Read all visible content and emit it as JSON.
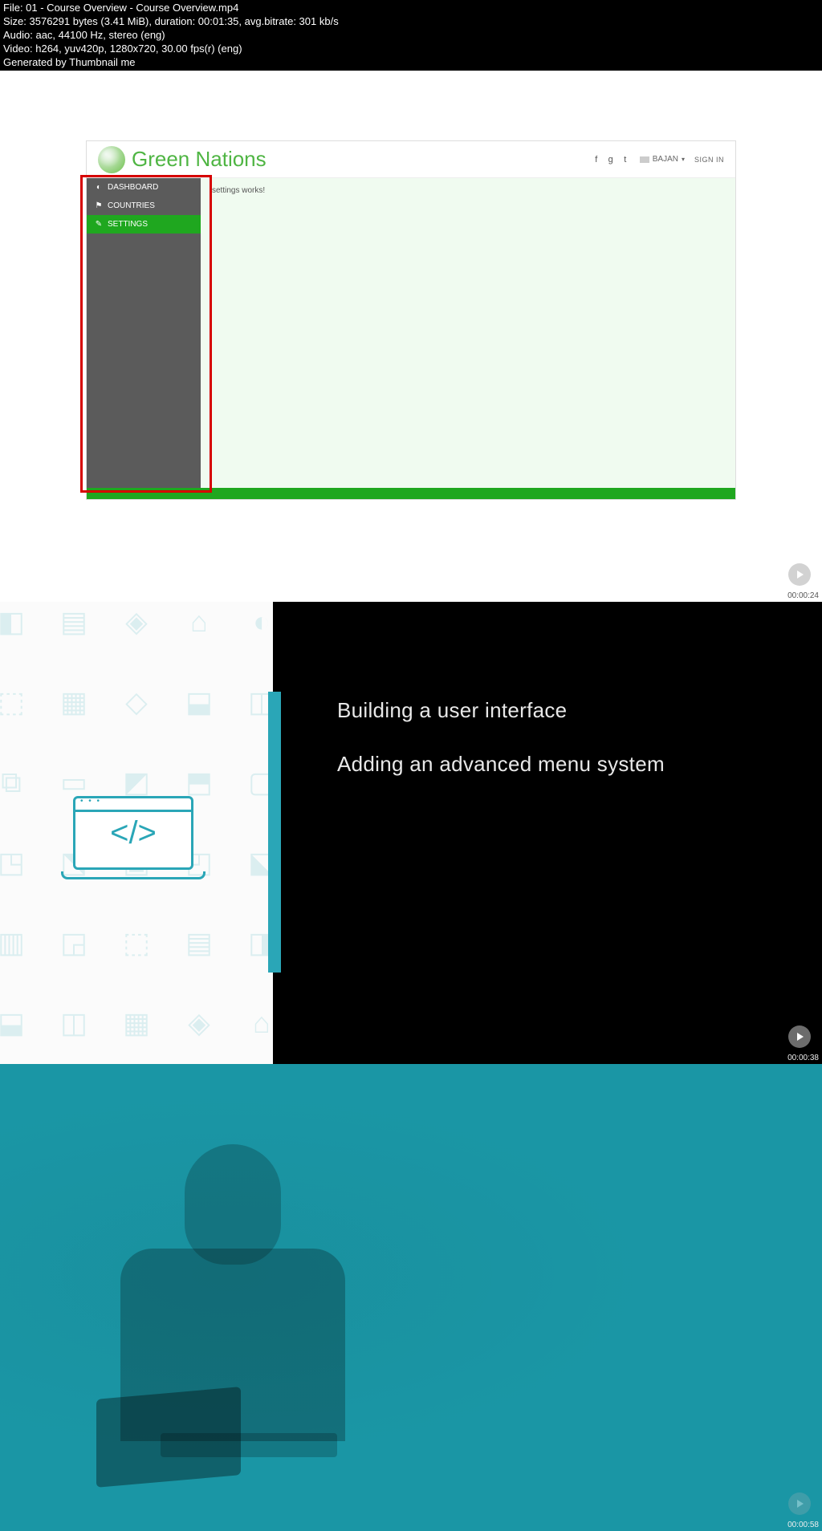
{
  "metadata": {
    "file": "File: 01 - Course Overview - Course Overview.mp4",
    "size": "Size: 3576291 bytes (3.41 MiB), duration: 00:01:35, avg.bitrate: 301 kb/s",
    "audio": "Audio: aac, 44100 Hz, stereo (eng)",
    "video": "Video: h264, yuv420p, 1280x720, 30.00 fps(r) (eng)",
    "generated": "Generated by Thumbnail me"
  },
  "thumb1": {
    "app_title": "Green Nations",
    "sidebar": {
      "items": [
        {
          "label": "DASHBOARD"
        },
        {
          "label": "COUNTRIES"
        },
        {
          "label": "SETTINGS"
        }
      ]
    },
    "content_text": "settings works!",
    "user_name": "BAJAN",
    "signin": "SIGN IN",
    "timestamp": "00:00:24"
  },
  "thumb2": {
    "line1": "Building a user interface",
    "line2": "Adding an advanced menu system",
    "code_glyph": "</>",
    "timestamp": "00:00:38"
  },
  "thumb3": {
    "timestamp": "00:00:58"
  }
}
